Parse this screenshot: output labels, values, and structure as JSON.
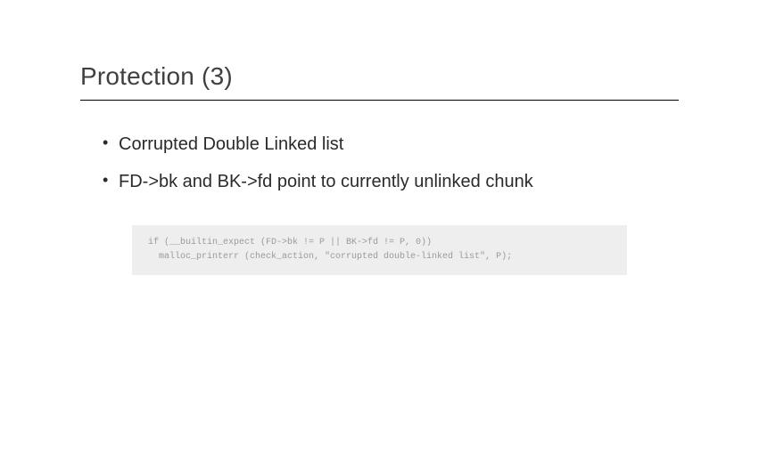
{
  "slide": {
    "title": "Protection (3)",
    "bullets": [
      "Corrupted Double Linked list",
      "FD->bk and BK->fd point to currently unlinked chunk"
    ],
    "code": {
      "line1": "if (__builtin_expect (FD->bk != P || BK->fd != P, 0))",
      "line2": "  malloc_printerr (check_action, \"corrupted double-linked list\", P);"
    }
  }
}
